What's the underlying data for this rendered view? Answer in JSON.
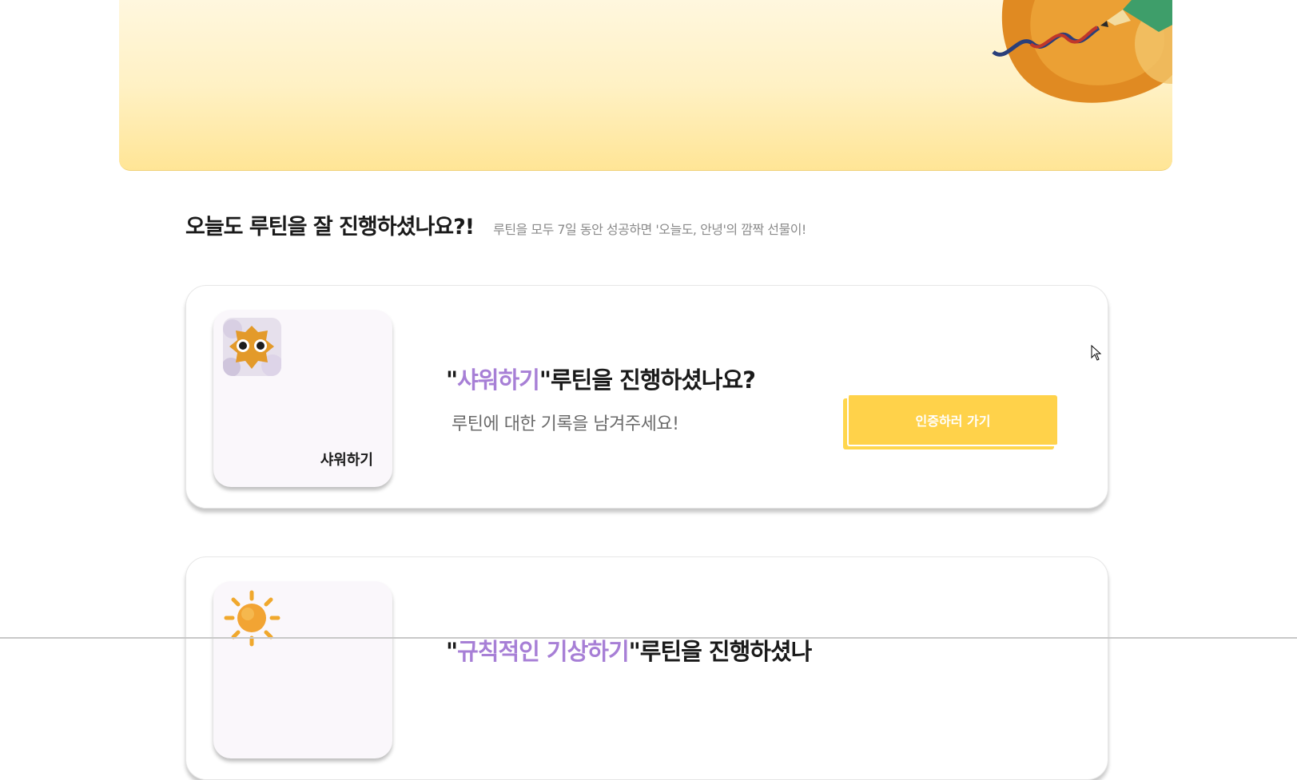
{
  "banner": {
    "illustration": "orange-blob-with-pencil-illustration"
  },
  "section": {
    "title": "오늘도 루틴을 잘 진행하셨나요?!",
    "subtitle": "루틴을 모두 7일 동안 성공하면 '오늘도, 안녕'의 깜짝 선물이!"
  },
  "routines": [
    {
      "name": "샤워하기",
      "icon": "owl-icon",
      "question_prefix": "\"",
      "question_highlight": "샤워하기",
      "question_suffix": "\"루틴을 진행하셨나요?",
      "prompt": "루틴에 대한 기록을 남겨주세요!",
      "button_label": "인증하러 가기"
    },
    {
      "name": "규칙적인 기상하기",
      "icon": "sun-icon",
      "question_prefix": "\"",
      "question_highlight": "규칙적인 기상하기",
      "question_suffix": "\"루틴을 진행하셨나"
    }
  ],
  "colors": {
    "accent_purple": "#a77fd6",
    "button_yellow": "#ffd24a",
    "banner_yellow": "#ffe596"
  }
}
